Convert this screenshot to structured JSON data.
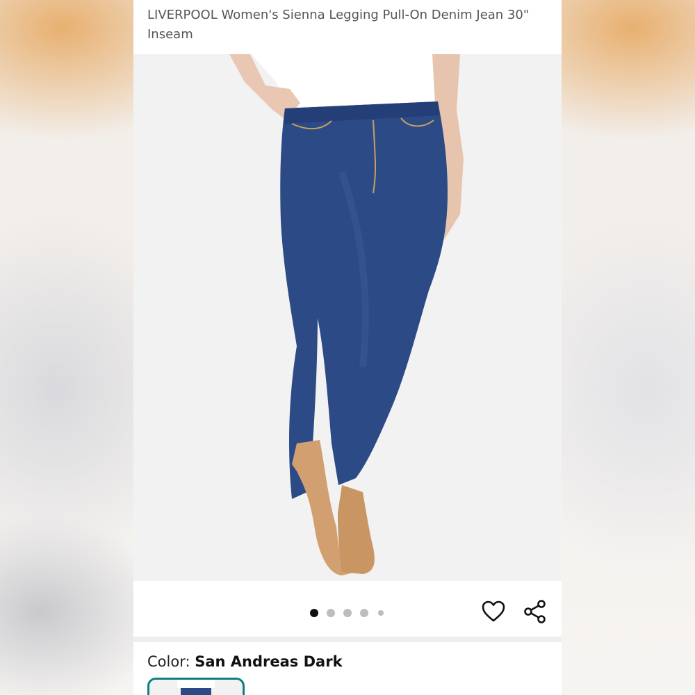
{
  "product": {
    "title": "LIVERPOOL Women's Sienna Legging Pull-On Denim Jean 30\" Inseam",
    "image_alt": "Dark wash pull-on denim leggings",
    "carousel": {
      "total_images": 5,
      "active_index": 0
    }
  },
  "actions": {
    "favorite_icon": "heart-outline-icon",
    "share_icon": "share-icon"
  },
  "color": {
    "label": "Color:",
    "value": "San Andreas Dark"
  },
  "theme": {
    "accent": "#0e7f80",
    "denim": "#2c4a86",
    "shoe": "#d2a070"
  }
}
